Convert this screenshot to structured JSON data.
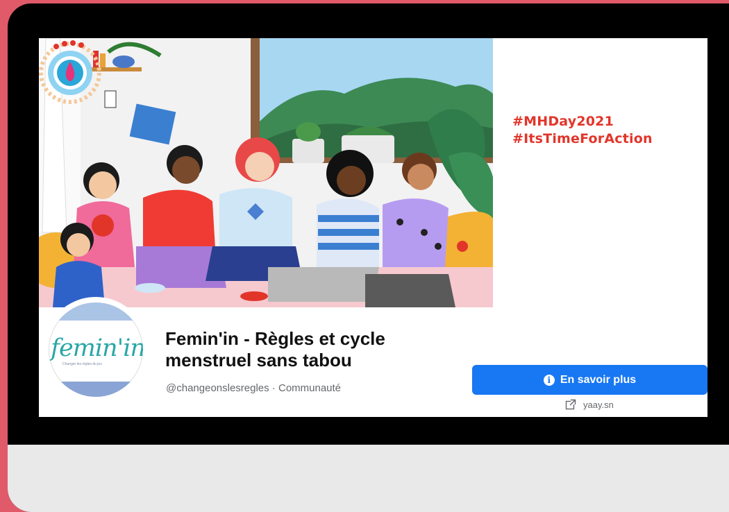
{
  "cover": {
    "hashtag_1": "#MHDay2021",
    "hashtag_2": "#ItsTimeForAction"
  },
  "profile": {
    "logo_text": "femin'in",
    "logo_tagline": "Changer les règles du jeu",
    "name": "Femin'in - Règles et cycle menstruel sans tabou",
    "handle": "@changeonslesregles · Communauté"
  },
  "actions": {
    "cta_label": "En savoir plus",
    "cta_icon": "info-icon",
    "website_icon": "external-link-icon",
    "website": "yaay.sn"
  },
  "colors": {
    "background": "#e05a6a",
    "cta": "#1877f2",
    "hashtag": "#e2352a",
    "logo": "#2aa6a6"
  }
}
